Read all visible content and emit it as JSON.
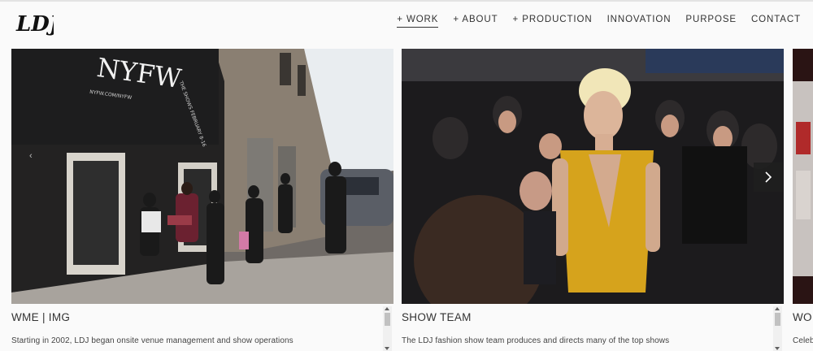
{
  "brand": {
    "logo_text": "LDJ"
  },
  "nav": {
    "items": [
      {
        "label": "+ WORK",
        "active": true
      },
      {
        "label": "+ ABOUT",
        "active": false
      },
      {
        "label": "+ PRODUCTION",
        "active": false
      },
      {
        "label": "INNOVATION",
        "active": false
      },
      {
        "label": "PURPOSE",
        "active": false
      },
      {
        "label": "CONTACT",
        "active": false
      }
    ]
  },
  "cards": [
    {
      "title": "WME | IMG",
      "description": "Starting in 2002, LDJ began onsite venue management and show operations",
      "photo_sign": "NYFW",
      "photo_sign_sub": "NYFW.COM/NYFW",
      "photo_sign_side": "THE SHOWS FEBRUARY 8-16"
    },
    {
      "title": "SHOW TEAM",
      "description": "The LDJ fashion show team produces and directs many of the top shows"
    },
    {
      "title": "WO",
      "description": "Celeb"
    }
  ],
  "controls": {
    "next_icon": "chevron-right-icon",
    "prev_marker": "‹"
  },
  "colors": {
    "accent_gold": "#d6a31c",
    "nav_text": "#333333"
  }
}
